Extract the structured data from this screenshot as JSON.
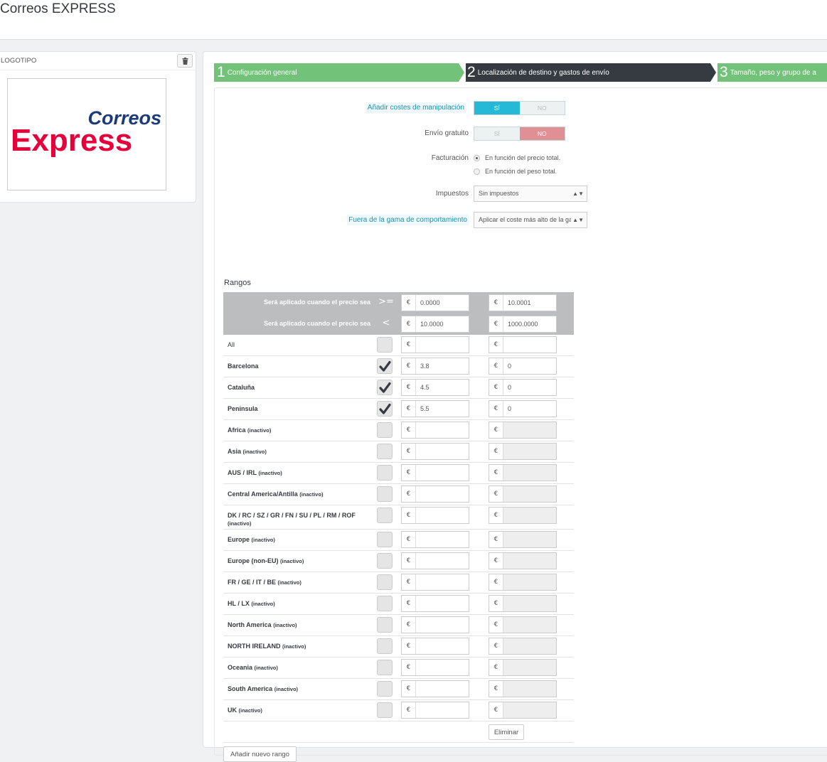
{
  "page": {
    "title": "Correos EXPRESS"
  },
  "logo_panel": {
    "title": "LOGOTIPO",
    "logo_word1": "Correos",
    "logo_word2": "Express"
  },
  "steps": [
    {
      "num": "1",
      "label": "Configuración general"
    },
    {
      "num": "2",
      "label": "Localización de destino y gastos de envío"
    },
    {
      "num": "3",
      "label": "Tamaño, peso y grupo de a"
    }
  ],
  "form": {
    "handling": {
      "label": "Añadir costes de manipulación",
      "yes": "SÍ",
      "no": "NO"
    },
    "free_shipping": {
      "label": "Envío gratuito",
      "yes": "SÍ",
      "no": "NO"
    },
    "billing": {
      "label": "Facturación",
      "options": [
        "En función del precio total.",
        "En función del peso total."
      ]
    },
    "taxes": {
      "label": "Impuestos",
      "value": "Sin impuestos"
    },
    "out_of_range": {
      "label": "Fuera de la gama de comportamiento",
      "value": "Aplicar el coste más alto de la gama"
    }
  },
  "ranges": {
    "title": "Rangos",
    "header_ge": {
      "text": "Será aplicado cuando el precio sea",
      "op": ">=",
      "values": [
        "0.0000",
        "10.0001"
      ]
    },
    "header_lt": {
      "text": "Será aplicado cuando el precio sea",
      "op": "<",
      "values": [
        "10.0000",
        "1000.0000"
      ]
    },
    "currency": "€",
    "zones": [
      {
        "name": "All",
        "inactive": "",
        "checked": false,
        "v1": "",
        "v2": ""
      },
      {
        "name": "Barcelona",
        "inactive": "",
        "checked": true,
        "v1": "3.8",
        "v2": "0"
      },
      {
        "name": "Cataluña",
        "inactive": "",
        "checked": true,
        "v1": "4.5",
        "v2": "0"
      },
      {
        "name": "Peninsula",
        "inactive": "",
        "checked": true,
        "v1": "5.5",
        "v2": "0"
      },
      {
        "name": "Africa",
        "inactive": "(inactivo)",
        "checked": false,
        "v1": "",
        "v2": ""
      },
      {
        "name": "Asia",
        "inactive": "(inactivo)",
        "checked": false,
        "v1": "",
        "v2": ""
      },
      {
        "name": "AUS / IRL",
        "inactive": "(inactivo)",
        "checked": false,
        "v1": "",
        "v2": ""
      },
      {
        "name": "Central America/Antilla",
        "inactive": "(inactivo)",
        "checked": false,
        "v1": "",
        "v2": ""
      },
      {
        "name": "DK / RC / SZ / GR / FN / SU / PL / RM / ROF",
        "inactive": "(inactivo)",
        "checked": false,
        "v1": "",
        "v2": ""
      },
      {
        "name": "Europe",
        "inactive": "(inactivo)",
        "checked": false,
        "v1": "",
        "v2": ""
      },
      {
        "name": "Europe (non-EU)",
        "inactive": "(inactivo)",
        "checked": false,
        "v1": "",
        "v2": ""
      },
      {
        "name": "FR / GE / IT / BE",
        "inactive": "(inactivo)",
        "checked": false,
        "v1": "",
        "v2": ""
      },
      {
        "name": "HL / LX",
        "inactive": "(inactivo)",
        "checked": false,
        "v1": "",
        "v2": ""
      },
      {
        "name": "North America",
        "inactive": "(inactivo)",
        "checked": false,
        "v1": "",
        "v2": ""
      },
      {
        "name": "NORTH IRELAND",
        "inactive": "(inactivo)",
        "checked": false,
        "v1": "",
        "v2": ""
      },
      {
        "name": "Oceania",
        "inactive": "(inactivo)",
        "checked": false,
        "v1": "",
        "v2": ""
      },
      {
        "name": "South America",
        "inactive": "(inactivo)",
        "checked": false,
        "v1": "",
        "v2": ""
      },
      {
        "name": "UK",
        "inactive": "(inactivo)",
        "checked": false,
        "v1": "",
        "v2": ""
      }
    ],
    "delete_label": "Eliminar",
    "add_label": "Añadir nuevo rango"
  },
  "colors": {
    "accent_blue": "#25b9d7",
    "step_green": "#72c279",
    "step_dark": "#363a41",
    "no_red": "#e08f95"
  }
}
